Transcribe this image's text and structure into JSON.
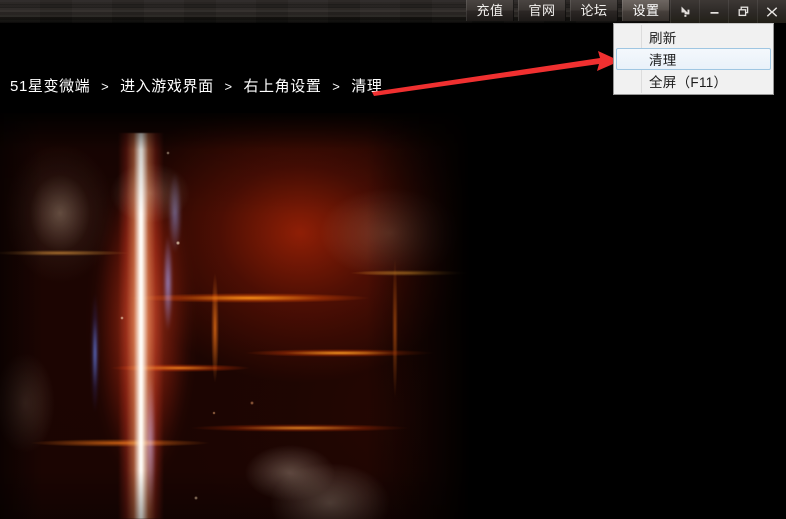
{
  "window": {
    "nav_buttons": [
      {
        "label": "充值",
        "name": "recharge",
        "active": false
      },
      {
        "label": "官网",
        "name": "official-site",
        "active": false
      },
      {
        "label": "论坛",
        "name": "forum",
        "active": false
      },
      {
        "label": "设置",
        "name": "settings",
        "active": true
      }
    ],
    "controls": [
      {
        "icon": "minimize-to-tray-icon",
        "name": "minimize-to-tray-button"
      },
      {
        "icon": "minimize-icon",
        "name": "minimize-button"
      },
      {
        "icon": "restore-icon",
        "name": "restore-button"
      },
      {
        "icon": "close-icon",
        "name": "close-button"
      }
    ]
  },
  "breadcrumb": {
    "separator": ">",
    "items": [
      "51星变微端",
      "进入游戏界面",
      "右上角设置",
      "清理"
    ]
  },
  "settings_menu": {
    "open": true,
    "items": [
      {
        "label": "刷新",
        "name": "menu-item-refresh",
        "hovered": false
      },
      {
        "label": "清理",
        "name": "menu-item-clean",
        "hovered": true
      },
      {
        "label": "全屏（F11）",
        "name": "menu-item-fullscreen",
        "hovered": false
      }
    ]
  },
  "annotation": {
    "arrow_color": "#f03030",
    "points_to": "清理"
  },
  "game_view": {
    "artwork_alt": "熔岩洞窟游戏场景，中央有明亮的闪电光柱"
  },
  "colors": {
    "titlebar_dark": "#231f1c",
    "nav_button": "#3a3532",
    "nav_button_active": "#58514c",
    "menu_background": "#f1f1f1",
    "menu_hover_fill": "#e9f1f9",
    "menu_hover_border": "#9fc6e2",
    "breadcrumb_text": "#ffffff",
    "arrow_red": "#f03030"
  }
}
